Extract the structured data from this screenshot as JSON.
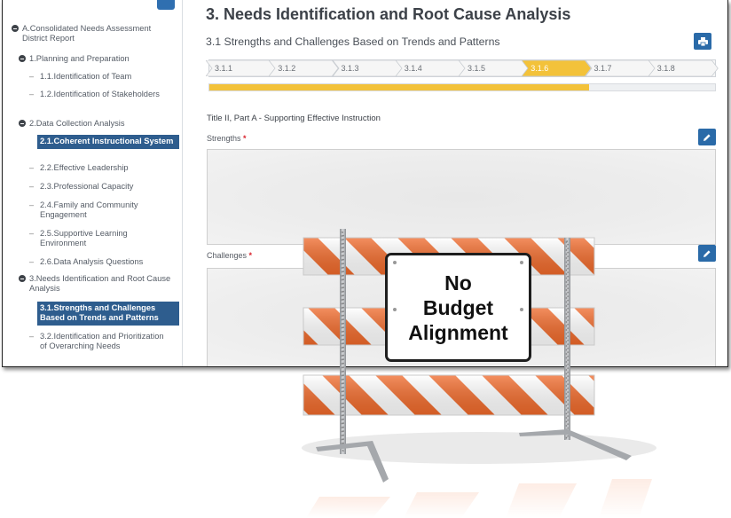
{
  "sidebar": {
    "items": [
      {
        "label": "A.Consolidated Needs Assessment District Report",
        "type": "group"
      },
      {
        "label": "1.Planning and Preparation",
        "type": "group"
      },
      {
        "label": "1.1.Identification of Team",
        "type": "item"
      },
      {
        "label": "1.2.Identification of Stakeholders",
        "type": "item"
      },
      {
        "label": "2.Data Collection Analysis",
        "type": "group"
      },
      {
        "label": "2.1.Coherent Instructional System",
        "type": "item",
        "active": true
      },
      {
        "label": "2.2.Effective Leadership",
        "type": "item"
      },
      {
        "label": "2.3.Professional Capacity",
        "type": "item"
      },
      {
        "label": "2.4.Family and Community Engagement",
        "type": "item"
      },
      {
        "label": "2.5.Supportive Learning Environment",
        "type": "item"
      },
      {
        "label": "2.6.Data Analysis Questions",
        "type": "item"
      },
      {
        "label": "3.Needs Identification and Root Cause Analysis",
        "type": "group"
      },
      {
        "label": "3.1.Strengths and Challenges Based on Trends and Patterns",
        "type": "item",
        "active": true
      },
      {
        "label": "3.2.Identification and Prioritization of Overarching Needs",
        "type": "item"
      }
    ]
  },
  "main": {
    "page_title": "3. Needs Identification and Root Cause Analysis",
    "section_title": "3.1 Strengths and Challenges Based on Trends and Patterns",
    "steps": [
      "3.1.1",
      "3.1.2",
      "3.1.3",
      "3.1.4",
      "3.1.5",
      "3.1.6",
      "3.1.7",
      "3.1.8"
    ],
    "current_step": "3.1.6",
    "progress_fraction": 0.75,
    "subtitle": "Title II, Part A - Supporting Effective Instruction",
    "strengths_label": "Strengths",
    "challenges_label": "Challenges",
    "required_mark": "*"
  },
  "sign": {
    "lines": [
      "No",
      "Budget",
      "Alignment"
    ]
  },
  "colors": {
    "accent": "#2a6aa8",
    "active_nav": "#2e5d8e",
    "progress": "#f3c23a",
    "required": "#d9232d",
    "stripe_orange": "#f06a2b"
  },
  "icons": {
    "print": "print-icon",
    "edit": "pencil-icon",
    "group_toggle": "minus-circle-icon"
  }
}
